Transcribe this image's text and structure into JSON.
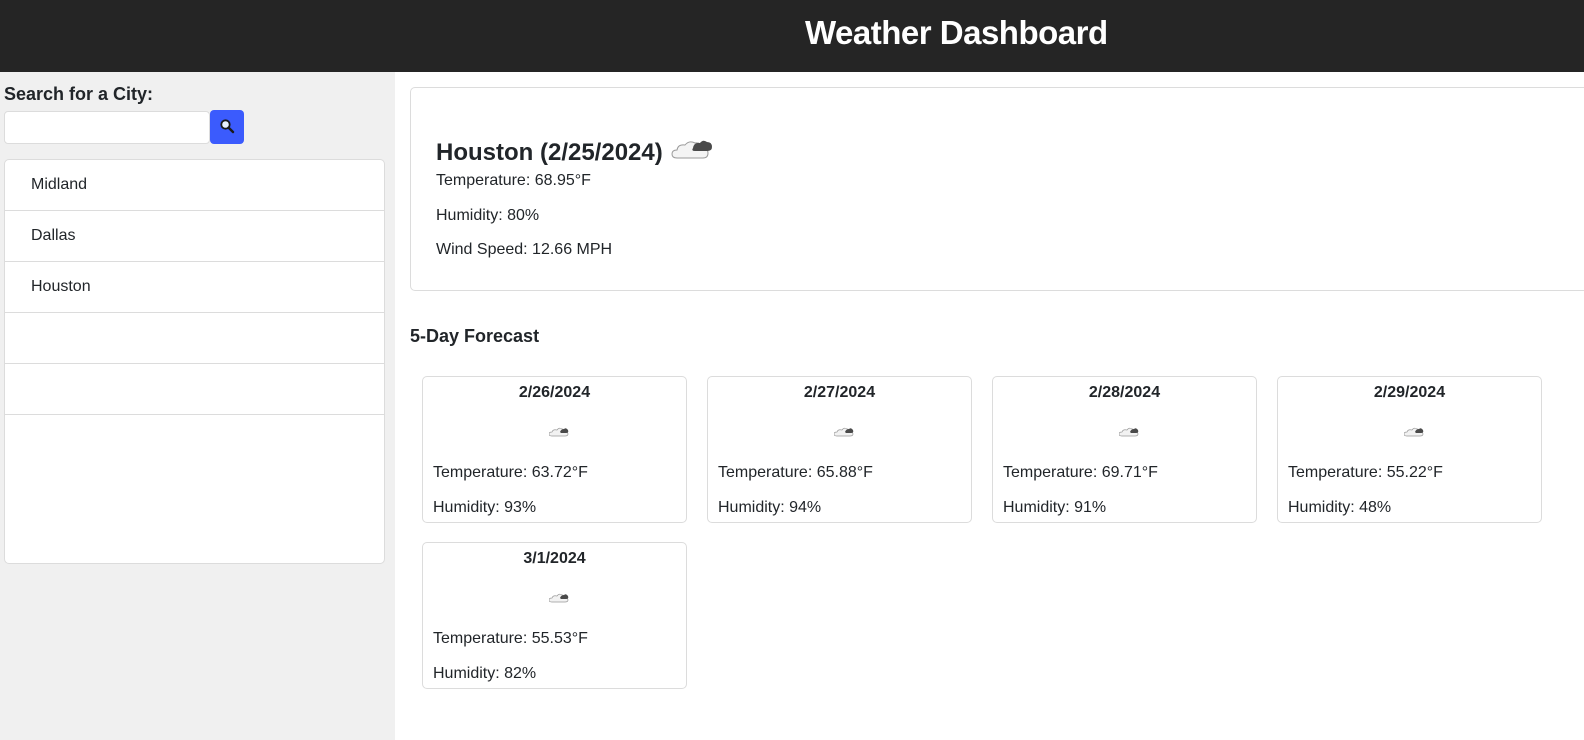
{
  "header": {
    "title": "Weather Dashboard"
  },
  "sidebar": {
    "search_label": "Search for a City:",
    "search_value": "",
    "search_icon": "magnifier-icon",
    "history": [
      "Midland",
      "Dallas",
      "Houston",
      "",
      ""
    ]
  },
  "current": {
    "title": "Houston (2/25/2024)",
    "icon": "cloud-icon",
    "temperature": "Temperature: 68.95°F",
    "humidity": "Humidity: 80%",
    "wind": "Wind Speed: 12.66 MPH"
  },
  "forecast": {
    "heading": "5-Day Forecast",
    "days": [
      {
        "date": "2/26/2024",
        "icon": "cloud-icon",
        "temp": "Temperature: 63.72°F",
        "humidity": "Humidity: 93%"
      },
      {
        "date": "2/27/2024",
        "icon": "cloud-icon",
        "temp": "Temperature: 65.88°F",
        "humidity": "Humidity: 94%"
      },
      {
        "date": "2/28/2024",
        "icon": "cloud-icon",
        "temp": "Temperature: 69.71°F",
        "humidity": "Humidity: 91%"
      },
      {
        "date": "2/29/2024",
        "icon": "cloud-icon",
        "temp": "Temperature: 55.22°F",
        "humidity": "Humidity: 48%"
      },
      {
        "date": "3/1/2024",
        "icon": "cloud-icon",
        "temp": "Temperature: 55.53°F",
        "humidity": "Humidity: 82%"
      }
    ]
  },
  "colors": {
    "header_bg": "#252525",
    "sidebar_bg": "#f0f0f0",
    "search_button": "#3b5bfd",
    "border": "#dcdcdc"
  }
}
